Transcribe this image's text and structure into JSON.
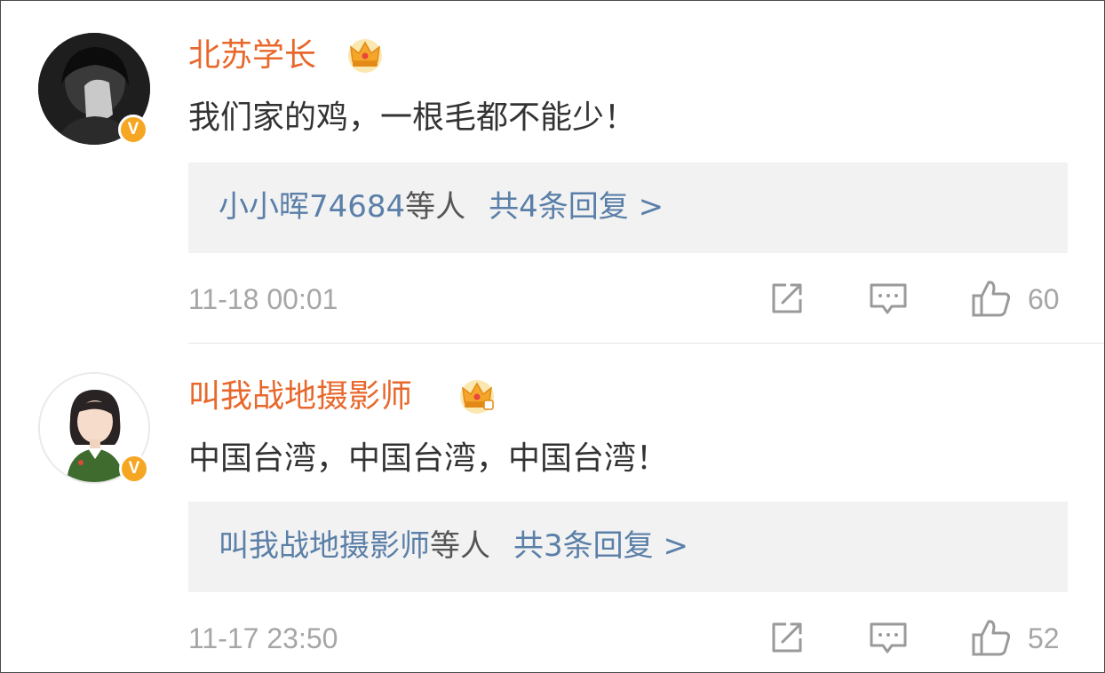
{
  "comments": [
    {
      "username": "北苏学长",
      "verified_icon": "verified-v-icon",
      "vip_icon": "crown-icon",
      "text": "我们家的鸡，一根毛都不能少！",
      "reply_preview_user": "小小晖74684",
      "reply_preview_suffix": "等人",
      "reply_count_label": "共4条回复 >",
      "timestamp": "11-18 00:01",
      "like_count": "60"
    },
    {
      "username": "叫我战地摄影师",
      "verified_icon": "verified-v-icon",
      "vip_icon": "crown-icon",
      "text": "中国台湾，中国台湾，中国台湾！",
      "reply_preview_user": "叫我战地摄影师",
      "reply_preview_suffix": "等人",
      "reply_count_label": "共3条回复 >",
      "timestamp": "11-17 23:50",
      "like_count": "52"
    }
  ],
  "colors": {
    "username": "#e8682c",
    "link_blue": "#5a7fa8",
    "verified_badge": "#f5a623",
    "reply_box_bg": "#f2f2f2",
    "meta_gray": "#a6a6a6"
  },
  "icons": {
    "share": "share-icon",
    "comment": "comment-icon",
    "like": "thumbs-up-icon",
    "verified_mark": "V"
  }
}
